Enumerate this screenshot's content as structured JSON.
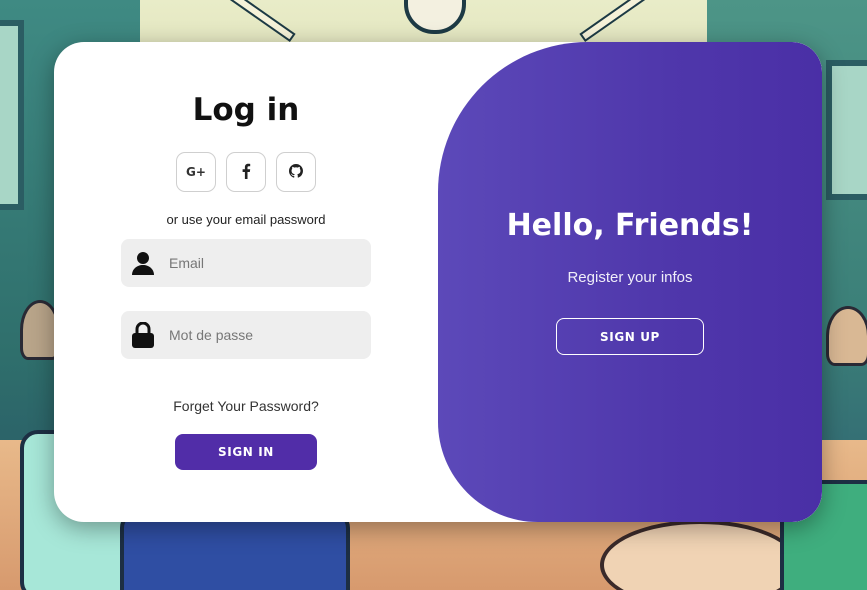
{
  "login": {
    "title": "Log in",
    "socials": [
      {
        "label": "G+",
        "icon": "google-plus-icon"
      },
      {
        "label": "f",
        "icon": "facebook-icon"
      },
      {
        "label": "",
        "icon": "github-icon"
      }
    ],
    "hint": "or use your email password",
    "email_placeholder": "Email",
    "password_placeholder": "Mot de passe",
    "forgot": "Forget Your Password?",
    "signin_label": "SIGN IN"
  },
  "panel": {
    "title": "Hello, Friends!",
    "subtitle": "Register your infos",
    "signup_label": "SIGN UP"
  },
  "colors": {
    "accent": "#512da8",
    "panel_gradient_start": "#5c49b9",
    "panel_gradient_end": "#4a2fa6",
    "input_bg": "#eeeeee"
  }
}
